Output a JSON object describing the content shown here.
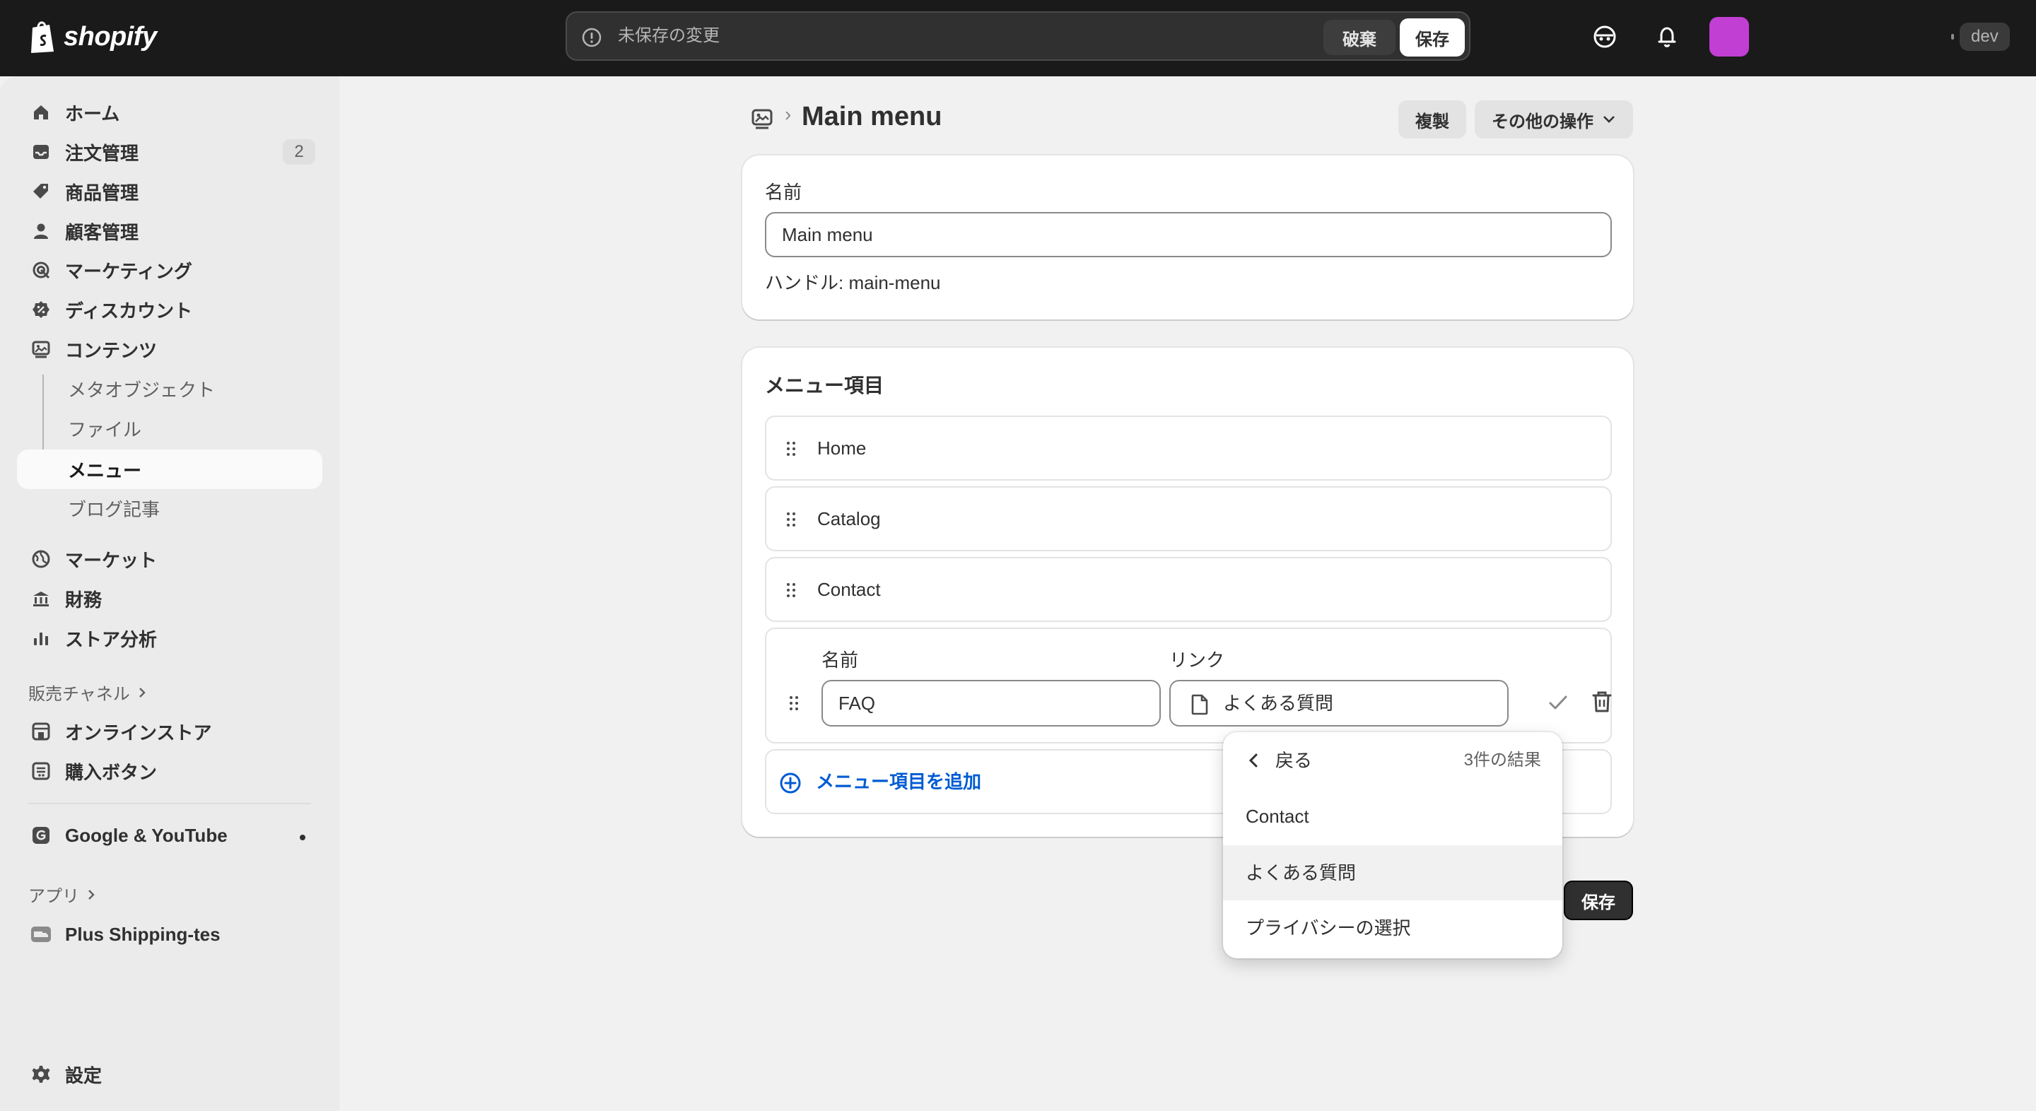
{
  "topbar": {
    "brand": "shopify",
    "unsaved_text": "未保存の変更",
    "discard_label": "破棄",
    "save_label": "保存",
    "store_badge": "dev",
    "avatar_color": "#c13fd3"
  },
  "sidebar": {
    "items": [
      {
        "label": "ホーム",
        "icon": "home-icon"
      },
      {
        "label": "注文管理",
        "icon": "orders-inbox-icon",
        "badge": "2"
      },
      {
        "label": "商品管理",
        "icon": "tag-icon"
      },
      {
        "label": "顧客管理",
        "icon": "person-icon"
      },
      {
        "label": "マーケティング",
        "icon": "target-icon"
      },
      {
        "label": "ディスカウント",
        "icon": "discount-icon"
      },
      {
        "label": "コンテンツ",
        "icon": "content-icon"
      }
    ],
    "content_sub": [
      "メタオブジェクト",
      "ファイル",
      "メニュー",
      "ブログ記事"
    ],
    "items2": [
      {
        "label": "マーケット",
        "icon": "globe-icon"
      },
      {
        "label": "財務",
        "icon": "bank-icon"
      },
      {
        "label": "ストア分析",
        "icon": "chart-bars-icon"
      }
    ],
    "sales_channels_label": "販売チャネル",
    "channels": [
      "オンラインストア",
      "購入ボタン"
    ],
    "google_label": "Google & YouTube",
    "apps_label": "アプリ",
    "app_item": "Plus Shipping-tes",
    "settings_label": "設定"
  },
  "header": {
    "title": "Main menu",
    "duplicate_label": "複製",
    "more_actions_label": "その他の操作"
  },
  "name_card": {
    "name_label": "名前",
    "name_value": "Main menu",
    "handle_text": "ハンドル: main-menu"
  },
  "menu_card": {
    "title": "メニュー項目",
    "rows": [
      "Home",
      "Catalog",
      "Contact"
    ],
    "edit_row": {
      "name_label": "名前",
      "name_value": "FAQ",
      "link_label": "リンク",
      "link_value": "よくある質問"
    },
    "add_label": "メニュー項目を追加"
  },
  "popover": {
    "back_label": "戻る",
    "count_label": "3件の結果",
    "options": [
      "Contact",
      "よくある質問",
      "プライバシーの選択"
    ]
  },
  "footer": {
    "save_label": "保存"
  }
}
